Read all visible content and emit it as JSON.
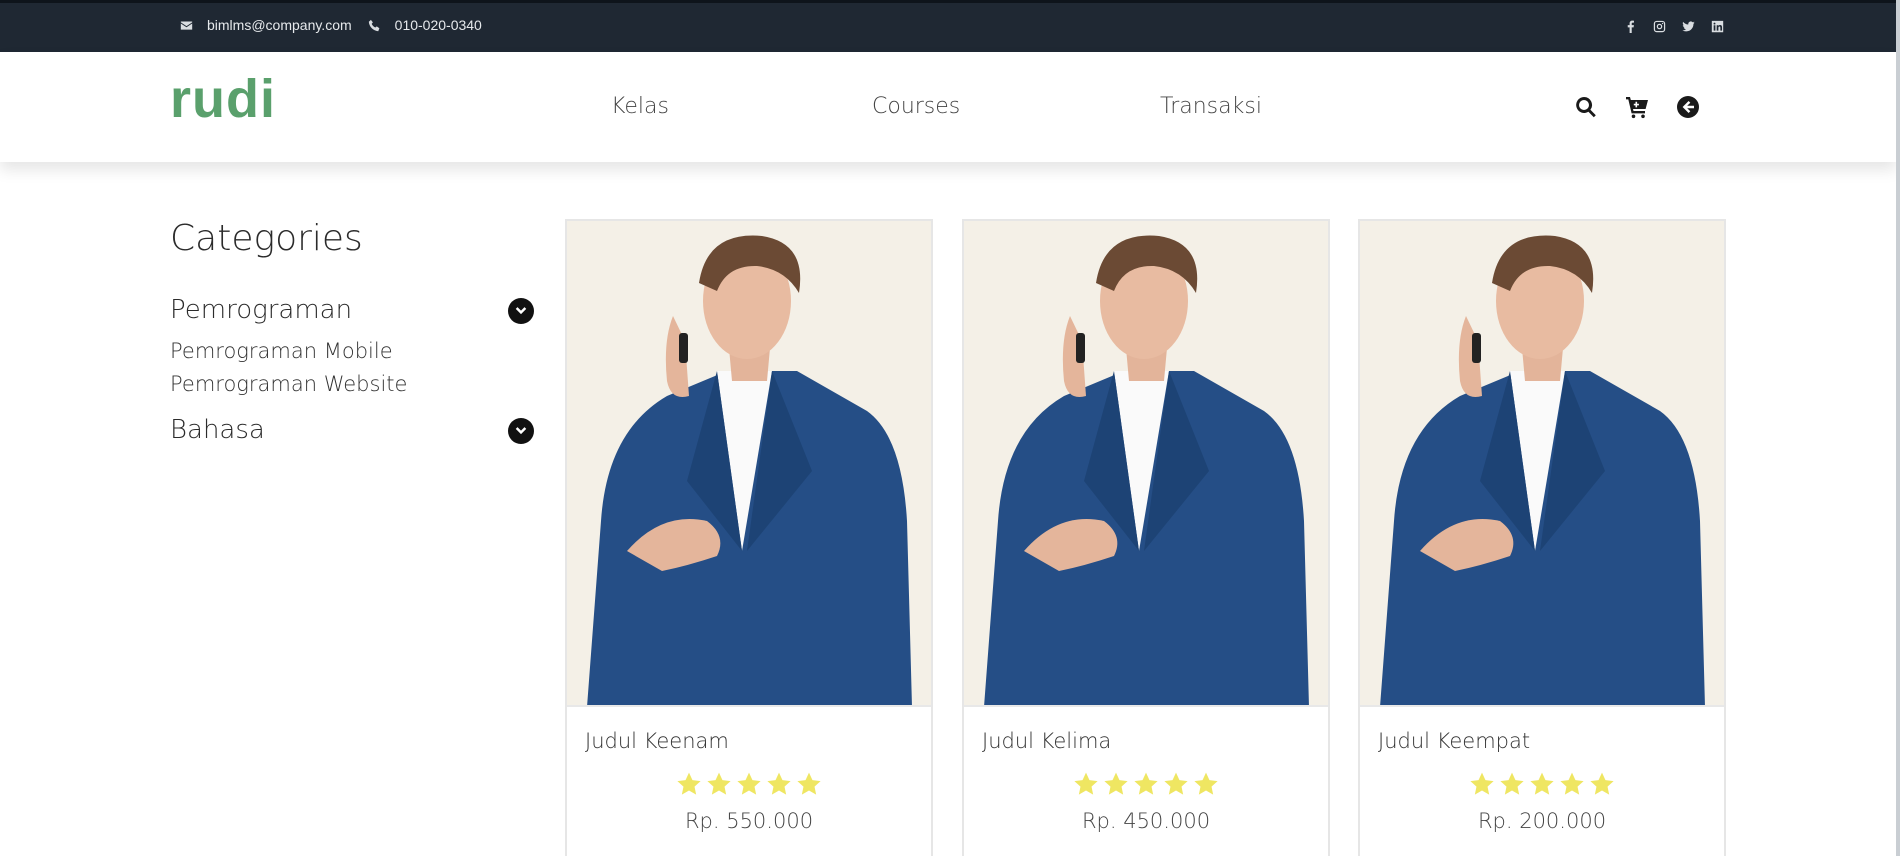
{
  "topbar": {
    "email": "bimlms@company.com",
    "phone": "010-020-0340",
    "icons": {
      "email": "envelope-icon",
      "phone": "phone-icon",
      "social": [
        "facebook-icon",
        "instagram-icon",
        "twitter-icon",
        "linkedin-icon"
      ]
    }
  },
  "navbar": {
    "logo": "rudi",
    "links": [
      "Kelas",
      "Courses",
      "Transaksi"
    ],
    "icons": [
      "search-icon",
      "cart-icon",
      "back-arrow-icon"
    ]
  },
  "sidebar": {
    "heading": "Categories",
    "categories": [
      {
        "title": "Pemrograman",
        "subcategories": [
          "Pemrograman Mobile",
          "Pemrograman Website"
        ]
      },
      {
        "title": "Bahasa",
        "subcategories": []
      }
    ]
  },
  "courses": [
    {
      "title": "Judul Keenam",
      "rating": 5,
      "price": "Rp. 550.000"
    },
    {
      "title": "Judul Kelima",
      "rating": 5,
      "price": "Rp. 450.000"
    },
    {
      "title": "Judul Keempat",
      "rating": 5,
      "price": "Rp. 200.000"
    }
  ],
  "colors": {
    "topbar_bg": "#1f2833",
    "logo": "#5aa06c",
    "star": "#efe662",
    "card_image_bg": "#f4f0e7"
  }
}
